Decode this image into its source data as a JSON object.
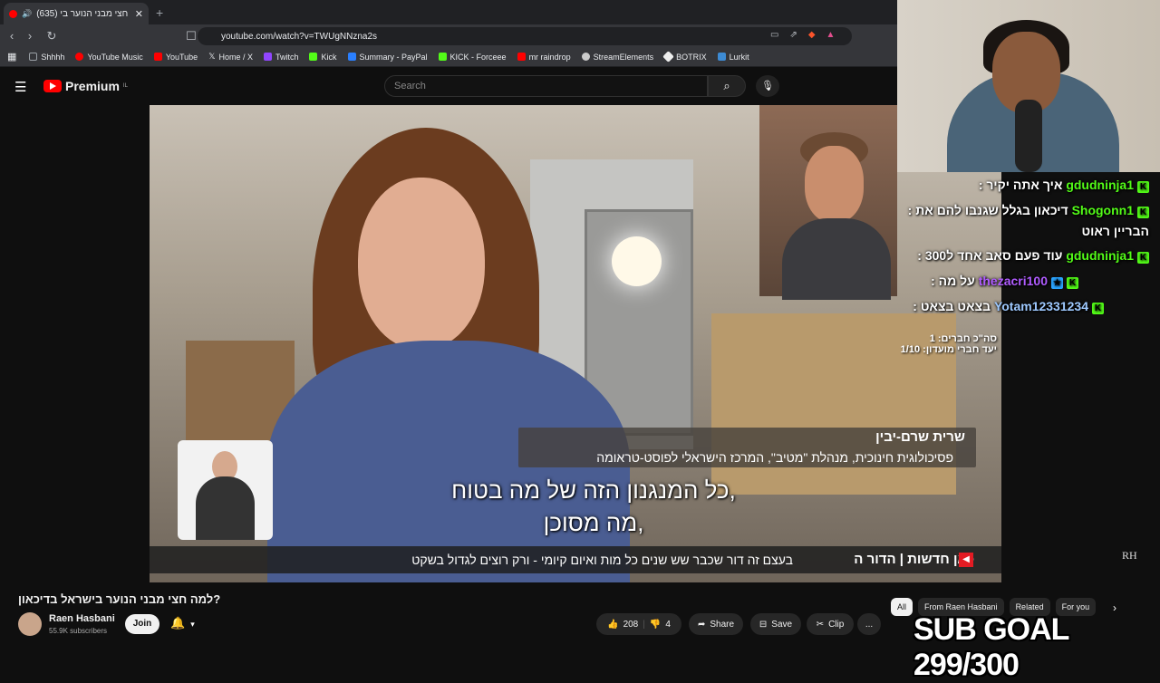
{
  "browser": {
    "tab_title": "(635) למה חצי מבני הנוער בי...",
    "new_tab": "+",
    "url": "youtube.com/watch?v=TWUgNNzna2s",
    "bookmarks": [
      {
        "label": "Shhhh",
        "color": "#9aa0a6"
      },
      {
        "label": "YouTube Music",
        "color": "#ff0000"
      },
      {
        "label": "YouTube",
        "color": "#ff0000"
      },
      {
        "label": "Home / X",
        "color": "#ffffff"
      },
      {
        "label": "Twitch",
        "color": "#9146ff"
      },
      {
        "label": "Kick",
        "color": "#53fc18"
      },
      {
        "label": "Summary - PayPal",
        "color": "#2a7fff"
      },
      {
        "label": "KICK - Forceee",
        "color": "#53fc18"
      },
      {
        "label": "mr raindrop",
        "color": "#ff0000"
      },
      {
        "label": "StreamElements",
        "color": "#cccccc"
      },
      {
        "label": "BOTRIX",
        "color": "#eeeeee"
      },
      {
        "label": "Lurkit",
        "color": "#3d8bd4"
      }
    ]
  },
  "youtube": {
    "logo_text": "Premium",
    "logo_region": "IL",
    "search_placeholder": "Search"
  },
  "video": {
    "caption_line1": "כל המנגנון הזה של מה בטוח,",
    "caption_line2": "מה מסוכן,",
    "name": "שרית שרם-יבין",
    "role": "פסיכולוגית חינוכית, מנהלת \"מטיב\", המרכז הישראלי לפוסט-טראומה",
    "ticker": "בעצם זה דור שכבר שש שנים כל מות ואיום קיומי - ורק רוצים לגדול בשקט",
    "ticker_brand": "כאן חדשות | הדור ה",
    "watermark": "RH"
  },
  "chat": {
    "messages": [
      {
        "user": "gdudninja1",
        "text": "איך אתה יקיר :"
      },
      {
        "user": "Shogonn1",
        "text": "דיכאון בגלל שגנבו להם את :"
      },
      {
        "user": "",
        "text": "הבריין ראוט"
      },
      {
        "user": "gdudninja1",
        "text": "עוד פעם סאב אחד ל300 :"
      },
      {
        "user": "thezacri100",
        "text": "על מה :"
      },
      {
        "user": "Yotam12331234",
        "text": "בצאט בצאט :"
      }
    ],
    "sub_total": "סה\"כ חברים: 1",
    "sub_goal_small": "יעד חברי מועדון: 1/10"
  },
  "below": {
    "title": "למה חצי מבני הנוער בישראל בדיכאון?",
    "channel": "Raen Hasbani",
    "subscribers": "55.9K subscribers",
    "join": "Join",
    "likes": "208",
    "dislikes": "4",
    "share": "Share",
    "save": "Save",
    "clip": "Clip",
    "more": "...",
    "chips": [
      "All",
      "From Raen Hasbani",
      "Related",
      "For you"
    ]
  },
  "overlay": {
    "sub_goal": "SUB GOAL 299/300"
  }
}
